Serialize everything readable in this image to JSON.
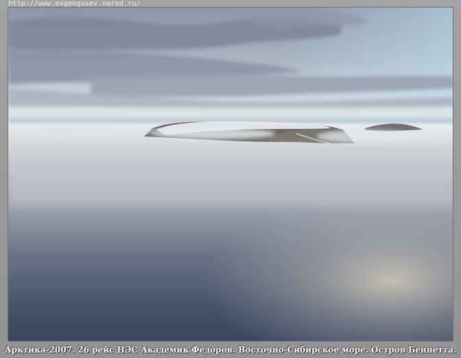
{
  "header": {
    "url": "http://www.evgengusev.narod.ru/"
  },
  "photo": {
    "subject": "",
    "colors": {
      "sky_top": "#9aa3b3",
      "sky_horizon": "#d8e3ea",
      "fog": "#c9cfd6",
      "sea": "#3c4760"
    }
  },
  "caption": {
    "text": "Арктика-2007. 26 рейс НЭС Академик Федоров. Восточно-Сибирское море. Остров Беннетта."
  }
}
